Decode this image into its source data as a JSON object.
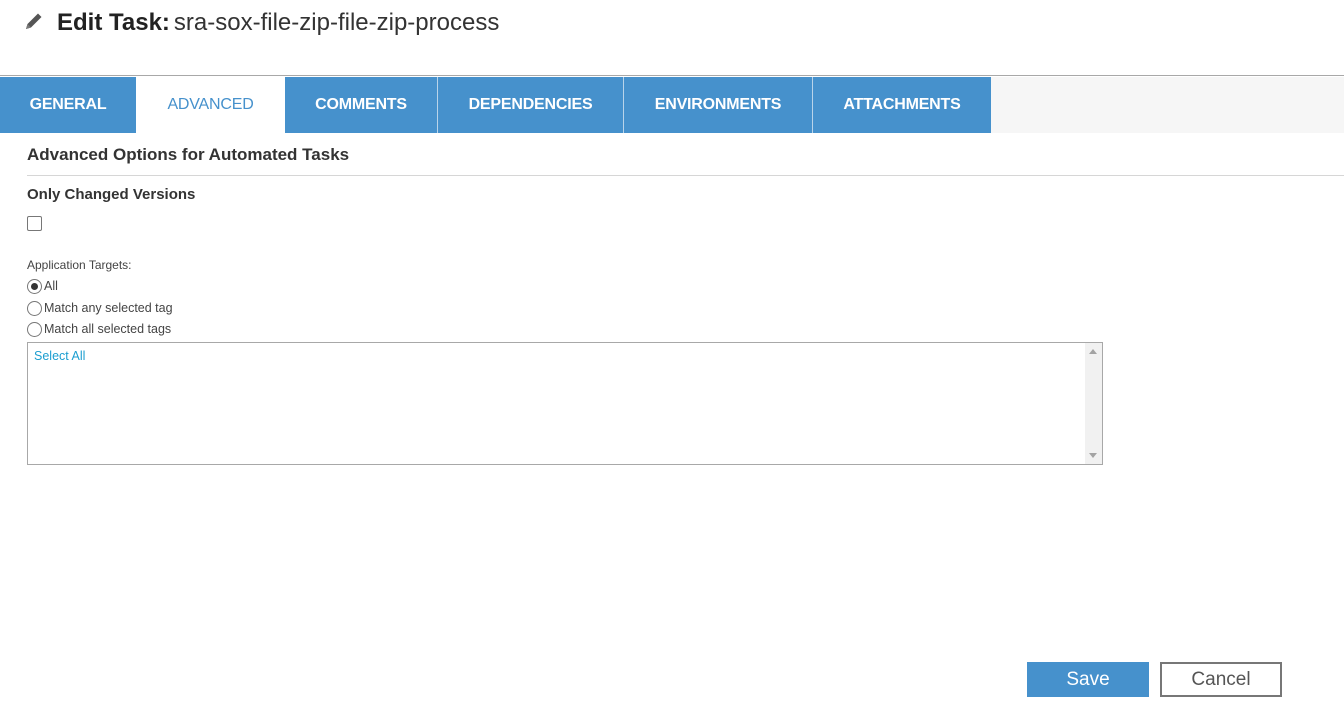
{
  "header": {
    "title_label": "Edit Task:",
    "task_name": "sra-sox-file-zip-file-zip-process",
    "icon": "pencil-icon"
  },
  "tabs": [
    {
      "label": "GENERAL",
      "active": false
    },
    {
      "label": "ADVANCED",
      "active": true
    },
    {
      "label": "COMMENTS",
      "active": false
    },
    {
      "label": "DEPENDENCIES",
      "active": false
    },
    {
      "label": "ENVIRONMENTS",
      "active": false
    },
    {
      "label": "ATTACHMENTS",
      "active": false
    }
  ],
  "section": {
    "title": "Advanced Options for Automated Tasks",
    "only_changed_label": "Only Changed Versions",
    "only_changed_checked": false,
    "targets_label": "Application Targets:",
    "radio_options": [
      {
        "label": "All",
        "checked": true
      },
      {
        "label": "Match any selected tag",
        "checked": false
      },
      {
        "label": "Match all selected tags",
        "checked": false
      }
    ],
    "select_all_label": "Select All"
  },
  "buttons": {
    "save_label": "Save",
    "cancel_label": "Cancel"
  },
  "colors": {
    "accent": "#4691cc",
    "link": "#1b9ed0"
  }
}
